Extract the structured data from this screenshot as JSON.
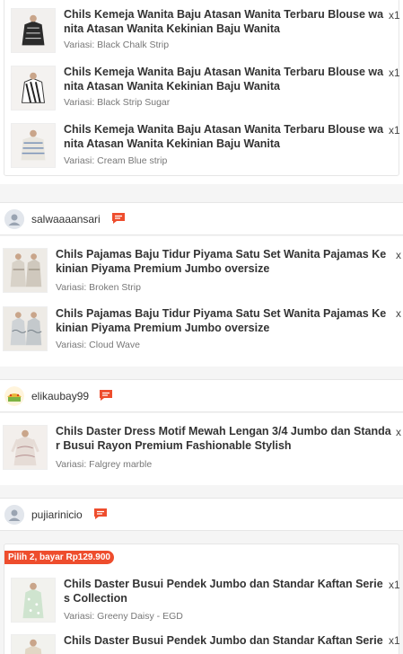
{
  "group1": {
    "items": [
      {
        "title": "Chils Kemeja Wanita Baju Atasan Wanita Terbaru Blouse wanita Atasan Wanita Kekinian Baju Wanita",
        "variant": "Variasi: Black Chalk Strip",
        "qty": "x1"
      },
      {
        "title": "Chils Kemeja Wanita Baju Atasan Wanita Terbaru Blouse wanita Atasan Wanita Kekinian Baju Wanita",
        "variant": "Variasi: Black Strip Sugar",
        "qty": "x1"
      },
      {
        "title": "Chils Kemeja Wanita Baju Atasan Wanita Terbaru Blouse wanita Atasan Wanita Kekinian Baju Wanita",
        "variant": "Variasi: Cream Blue strip",
        "qty": "x1"
      }
    ]
  },
  "shops": [
    {
      "name": "salwaaaansari",
      "items": [
        {
          "title": "Chils Pajamas Baju Tidur Piyama Satu Set Wanita Pajamas Kekinian Piyama Premium Jumbo oversize",
          "variant": "Variasi: Broken Strip",
          "qty": "x"
        },
        {
          "title": "Chils Pajamas Baju Tidur Piyama Satu Set Wanita Pajamas Kekinian Piyama Premium Jumbo oversize",
          "variant": "Variasi: Cloud Wave",
          "qty": "x"
        }
      ]
    },
    {
      "name": "elikaubay99",
      "items": [
        {
          "title": "Chils Daster Dress Motif Mewah Lengan 3/4 Jumbo dan Standar Busui Rayon Premium Fashionable Stylish",
          "variant": "Variasi: Falgrey marble",
          "qty": "x"
        }
      ]
    },
    {
      "name": "pujiarinicio",
      "promo": "Pilih 2, bayar Rp129.900",
      "items": [
        {
          "title": "Chils Daster Busui Pendek Jumbo dan Standar Kaftan Series Collection",
          "variant": "Variasi: Greeny Daisy - EGD",
          "qty": "x1"
        },
        {
          "title": "Chils Daster Busui Pendek Jumbo dan Standar Kaftan Series Co",
          "variant": "",
          "qty": "x1"
        }
      ]
    }
  ],
  "icons": {
    "chat": "chat-icon",
    "avatar": "user-avatar-icon"
  },
  "colors": {
    "accent": "#ee4d2d",
    "background": "#f5f5f5"
  }
}
